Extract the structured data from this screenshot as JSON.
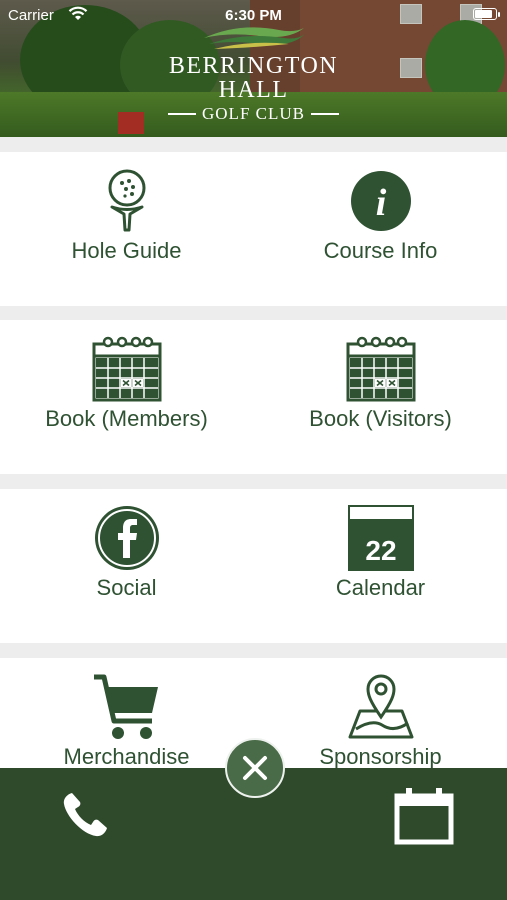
{
  "status_bar": {
    "carrier": "Carrier",
    "time": "6:30 PM",
    "battery_level": 0.95
  },
  "header": {
    "logo_line1": "BERRINGTON",
    "logo_line2": "HALL",
    "logo_line3": "GOLF CLUB"
  },
  "tiles": [
    {
      "label": "Hole Guide",
      "icon": "golf-ball-tee-icon"
    },
    {
      "label": "Course Info",
      "icon": "info-icon"
    },
    {
      "label": "Book (Members)",
      "icon": "booking-calendar-icon"
    },
    {
      "label": "Book (Visitors)",
      "icon": "booking-calendar-icon"
    },
    {
      "label": "Social",
      "icon": "facebook-icon"
    },
    {
      "label": "Calendar",
      "icon": "calendar-icon",
      "day": "22"
    },
    {
      "label": "Merchandise",
      "icon": "cart-icon"
    },
    {
      "label": "Sponsorship",
      "icon": "map-pin-icon"
    }
  ],
  "bottom_bar": {
    "left_icon": "phone-icon",
    "right_icon": "calendar-icon",
    "center_icon": "close-icon"
  },
  "colors": {
    "brand_green": "#2f5233",
    "bar_green": "#2e4a2b",
    "background": "#ededed"
  }
}
